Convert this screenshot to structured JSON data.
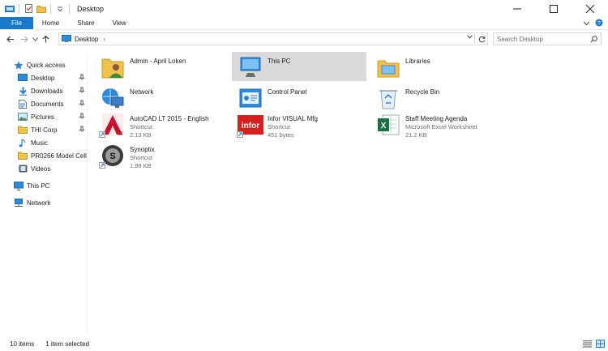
{
  "window": {
    "title": "Desktop"
  },
  "ribbon": {
    "tabs": [
      "File",
      "Home",
      "Share",
      "View"
    ]
  },
  "address": {
    "path": "Desktop",
    "separator": "›"
  },
  "search": {
    "placeholder": "Search Desktop"
  },
  "sidebar": {
    "items": [
      {
        "label": "Quick access",
        "icon": "star-icon",
        "pinned": false
      },
      {
        "label": "Desktop",
        "icon": "desktop-folder-icon",
        "pinned": true
      },
      {
        "label": "Downloads",
        "icon": "download-arrow-icon",
        "pinned": true
      },
      {
        "label": "Documents",
        "icon": "documents-icon",
        "pinned": true
      },
      {
        "label": "Pictures",
        "icon": "pictures-icon",
        "pinned": true
      },
      {
        "label": "THI Corp",
        "icon": "folder-icon",
        "pinned": true
      },
      {
        "label": "Music",
        "icon": "music-note-icon",
        "pinned": false
      },
      {
        "label": "PR0266 Model Cell",
        "icon": "folder-icon",
        "pinned": false
      },
      {
        "label": "Videos",
        "icon": "videos-icon",
        "pinned": false
      },
      {
        "label": "This PC",
        "icon": "monitor-icon",
        "pinned": false
      },
      {
        "label": "Network",
        "icon": "network-icon",
        "pinned": false
      }
    ]
  },
  "files": [
    {
      "name": "Admin - April Loken",
      "sub1": "",
      "sub2": "",
      "icon": "user-folder-icon"
    },
    {
      "name": "This PC",
      "sub1": "",
      "sub2": "",
      "icon": "this-pc-icon"
    },
    {
      "name": "Libraries",
      "sub1": "",
      "sub2": "",
      "icon": "libraries-icon"
    },
    {
      "name": "Network",
      "sub1": "",
      "sub2": "",
      "icon": "network-globe-icon"
    },
    {
      "name": "Control Panel",
      "sub1": "",
      "sub2": "",
      "icon": "control-panel-icon"
    },
    {
      "name": "Recycle Bin",
      "sub1": "",
      "sub2": "",
      "icon": "recycle-bin-icon"
    },
    {
      "name": "AutoCAD LT 2015 - English",
      "sub1": "Shortcut",
      "sub2": "2.13 KB",
      "icon": "autocad-icon"
    },
    {
      "name": "Infor VISUAL Mfg",
      "sub1": "Shortcut",
      "sub2": "451 bytes",
      "icon": "infor-icon"
    },
    {
      "name": "Staff Meeting Agenda",
      "sub1": "Microsoft Excel Worksheet",
      "sub2": "21.2 KB",
      "icon": "excel-icon"
    },
    {
      "name": "Synoptix",
      "sub1": "Shortcut",
      "sub2": "1.89 KB",
      "icon": "synoptix-icon"
    }
  ],
  "status": {
    "count": "10 items",
    "selection": "1 item selected"
  },
  "colors": {
    "accent": "#1979ca",
    "selected": "#d9d9d9",
    "folder": "#f0c24b"
  }
}
